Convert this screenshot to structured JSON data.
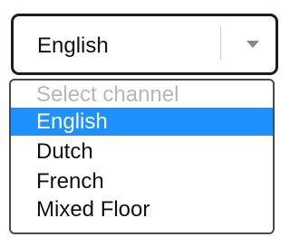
{
  "select": {
    "value": "English"
  },
  "dropdown": {
    "placeholder": "Select channel",
    "options": [
      "English",
      "Dutch",
      "French",
      "Mixed Floor"
    ]
  },
  "colors": {
    "selected_bg": "#1e90ff",
    "selected_text": "#ffffff",
    "placeholder_text": "#b7b7b7",
    "border": "#1d1d1d"
  }
}
